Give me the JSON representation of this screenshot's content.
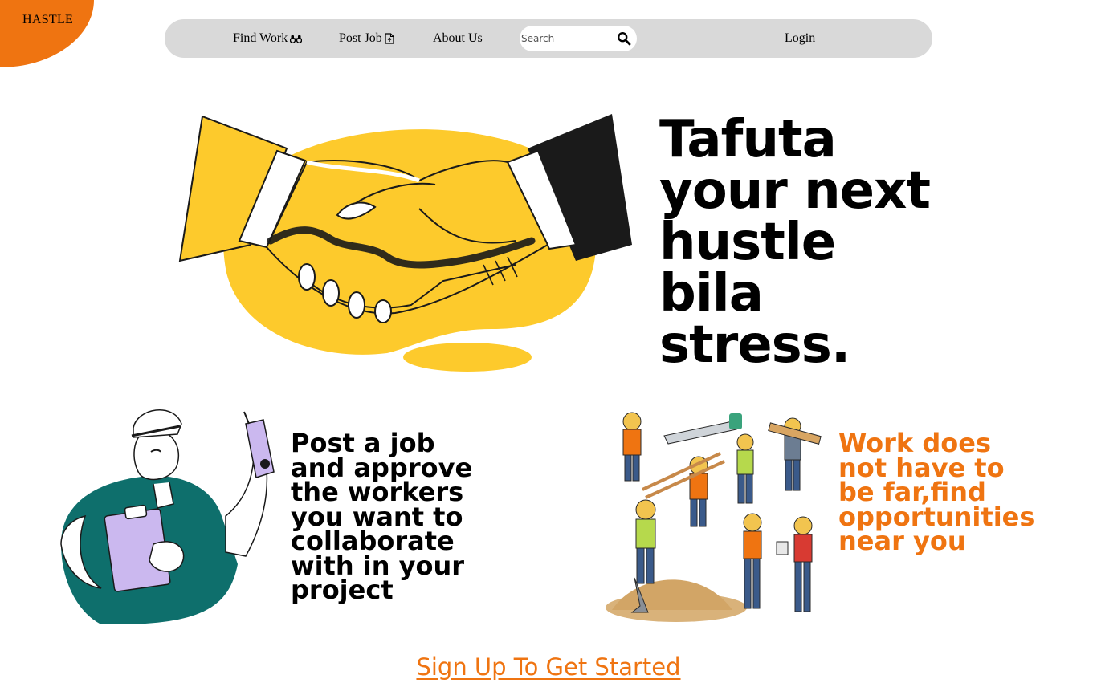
{
  "brand": {
    "name": "HASTLE",
    "color": "#ef7411"
  },
  "nav": {
    "find_work": {
      "label": "Find Work",
      "icon": "binoculars-icon"
    },
    "post_job": {
      "label": "Post Job",
      "icon": "file-upload-icon"
    },
    "about_us": {
      "label": "About Us"
    },
    "search": {
      "placeholder": "Search",
      "value": "",
      "icon": "search-icon"
    },
    "login": {
      "label": "Login"
    }
  },
  "hero": {
    "lines": [
      "Tafuta",
      "your next",
      "hustle",
      "bila",
      "stress."
    ],
    "image": "handshake-illustration"
  },
  "features": {
    "post": {
      "lines": [
        "Post a job",
        "and approve",
        "the workers",
        "you want to",
        "collaborate",
        "with in your",
        "project"
      ],
      "image": "worker-with-clipboard-illustration"
    },
    "work": {
      "lines": [
        "Work does",
        "not have to",
        "be far,find",
        "opportunities",
        "near you"
      ],
      "image": "construction-crew-illustration"
    }
  },
  "cta": {
    "label": "Sign Up To Get Started"
  }
}
